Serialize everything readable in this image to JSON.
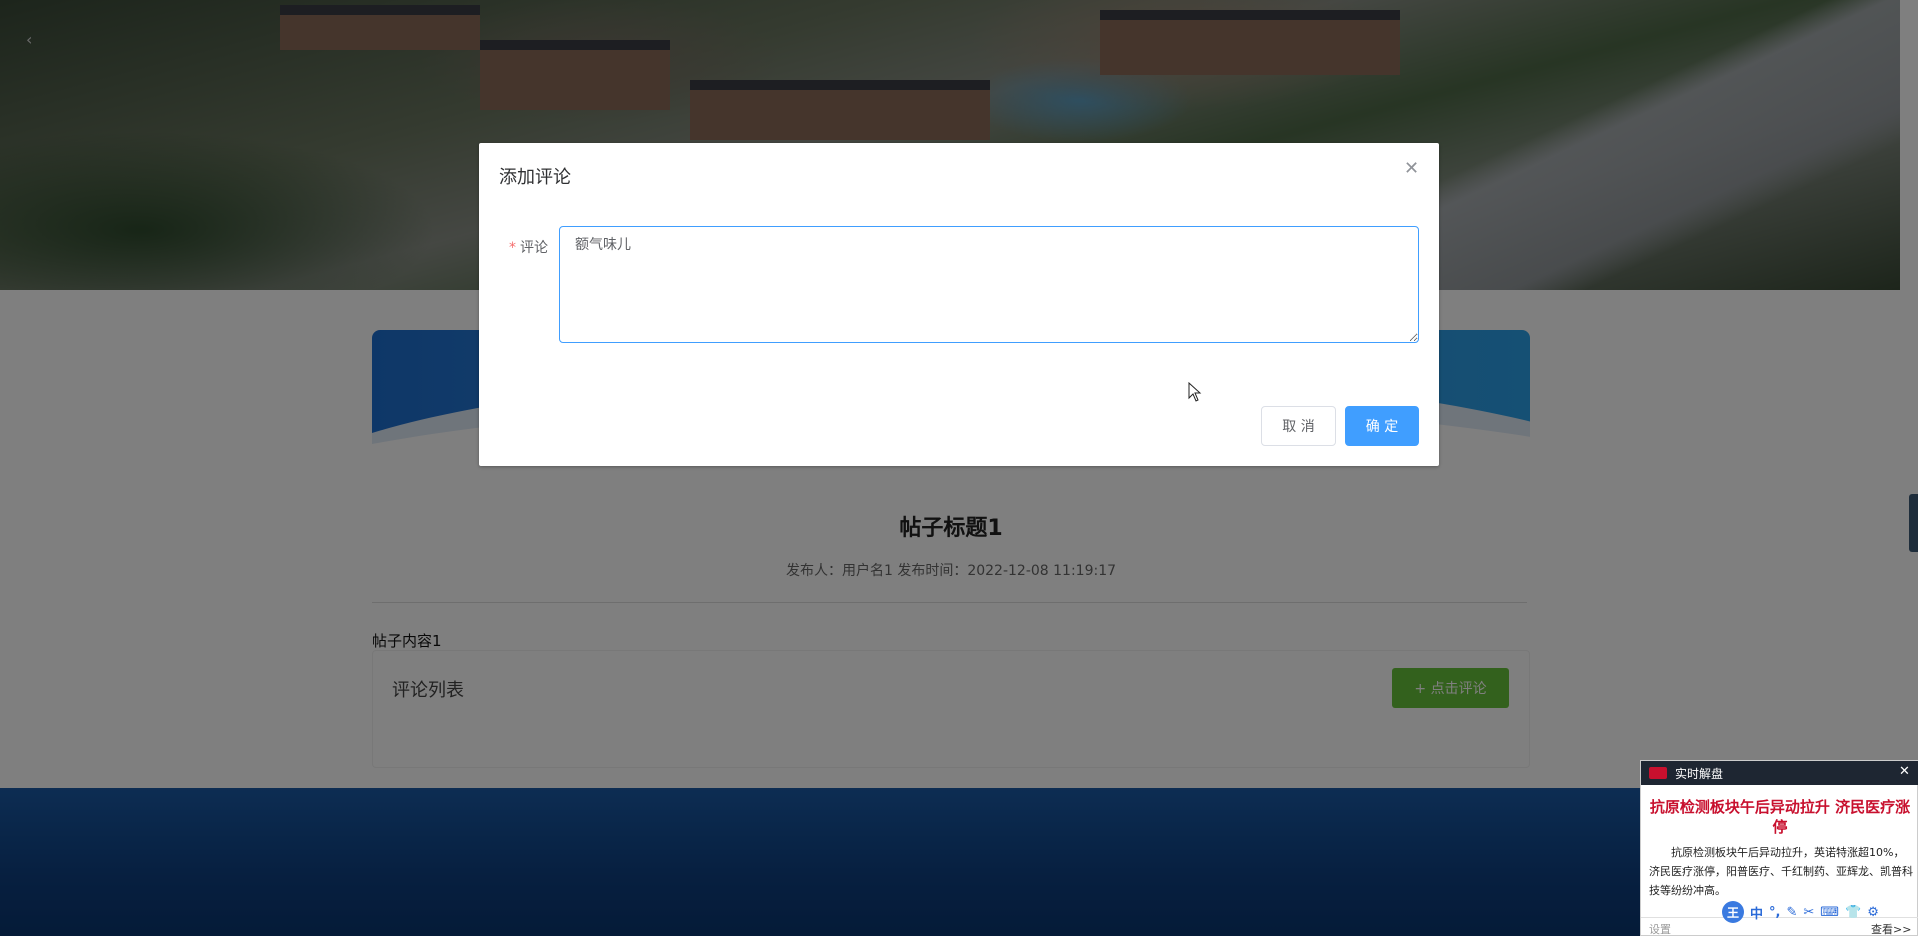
{
  "dialog": {
    "title": "添加评论",
    "close_icon": "close-icon",
    "field_label": "评论",
    "required_mark": "*",
    "comment_value": "额气味儿",
    "cancel_label": "取 消",
    "confirm_label": "确 定"
  },
  "post": {
    "title": "帖子标题1",
    "meta": "发布人：用户名1  发布时间：2022-12-08 11:19:17",
    "content": "帖子内容1",
    "comment_list_title": "评论列表",
    "add_comment_label": "+ 点击评论"
  },
  "news_popup": {
    "header_label": "实时解盘",
    "headline": "抗原检测板块午后异动拉升 济民医疗涨停",
    "body": "抗原检测板块午后异动拉升，英诺特涨超10%，济民医疗涨停，阳普医疗、千红制药、亚辉龙、凯普科技等纷纷冲高。",
    "settings_label": "设置",
    "more_label": "查看>>",
    "close_glyph": "✕"
  },
  "ime_toolbar": {
    "logo": "王",
    "items": [
      "中",
      "°,",
      "✎",
      "✂",
      "⌨",
      "👕",
      "⚙"
    ]
  },
  "colors": {
    "primary": "#409eff",
    "success": "#67c23a",
    "required": "#f56c6c",
    "footer": "#1a5aa6",
    "news_red": "#c8102e"
  }
}
